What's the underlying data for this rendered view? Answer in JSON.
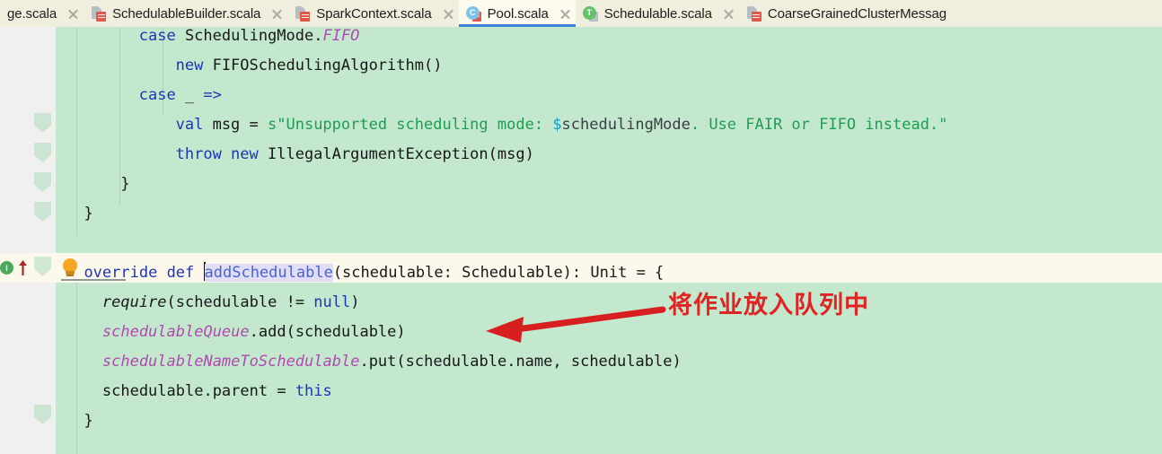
{
  "tabs": [
    {
      "label": "ge.scala",
      "icon": "scala-file-icon",
      "active": false,
      "truncated_left": true
    },
    {
      "label": "SchedulableBuilder.scala",
      "icon": "scala-file-icon",
      "active": false
    },
    {
      "label": "SparkContext.scala",
      "icon": "scala-file-icon",
      "active": false
    },
    {
      "label": "Pool.scala",
      "icon": "scala-class-icon",
      "active": true,
      "icon_letter": "C"
    },
    {
      "label": "Schedulable.scala",
      "icon": "scala-trait-icon",
      "active": false,
      "icon_letter": "T"
    },
    {
      "label": "CoarseGrainedClusterMessag",
      "icon": "scala-file-icon",
      "active": false,
      "truncated_right": true
    }
  ],
  "gutter": {
    "implementation_marker_letter": "I",
    "implementing_method_arrow": "override-arrow-up"
  },
  "editor": {
    "language": "scala",
    "lines": [
      {
        "indent": 4,
        "clipped_top": true,
        "tokens": [
          {
            "t": "case ",
            "c": "kw"
          },
          {
            "t": "SchedulingMode.",
            "c": "ident"
          },
          {
            "t": "FIFO",
            "c": "fld"
          }
        ]
      },
      {
        "indent": 6,
        "tokens": [
          {
            "t": "new ",
            "c": "kw"
          },
          {
            "t": "FIFOSchedulingAlgorithm()",
            "c": "ident"
          }
        ]
      },
      {
        "indent": 4,
        "tokens": [
          {
            "t": "case ",
            "c": "kw"
          },
          {
            "t": "_ ",
            "c": "ident"
          },
          {
            "t": "=>",
            "c": "kw"
          }
        ]
      },
      {
        "indent": 6,
        "tokens": [
          {
            "t": "val ",
            "c": "kw"
          },
          {
            "t": "msg ",
            "c": "ident"
          },
          {
            "t": "= ",
            "c": "ident"
          },
          {
            "t": "s\"Unsupported scheduling mode: ",
            "c": "str"
          },
          {
            "t": "$",
            "c": "itp"
          },
          {
            "t": "schedulingMode",
            "c": "itpv"
          },
          {
            "t": ". Use FAIR or FIFO instead.\"",
            "c": "str"
          }
        ]
      },
      {
        "indent": 6,
        "tokens": [
          {
            "t": "throw ",
            "c": "kw"
          },
          {
            "t": "new ",
            "c": "kw"
          },
          {
            "t": "IllegalArgumentException(msg)",
            "c": "ident"
          }
        ]
      },
      {
        "indent": 3,
        "tokens": [
          {
            "t": "}",
            "c": "ident"
          }
        ]
      },
      {
        "indent": 1,
        "tokens": [
          {
            "t": "}",
            "c": "ident"
          }
        ]
      },
      {
        "blank": true
      },
      {
        "indent": 1,
        "current": true,
        "tokens": [
          {
            "t": "override ",
            "c": "kw"
          },
          {
            "t": "def ",
            "c": "kw"
          },
          {
            "t": "|CARET|",
            "c": "caret"
          },
          {
            "t": "addSchedulable",
            "c": "sel-ident"
          },
          {
            "t": "(schedulable: Schedulable): Unit = {",
            "c": "ident"
          }
        ]
      },
      {
        "indent": 2,
        "tokens": [
          {
            "t": "require",
            "c": "mth"
          },
          {
            "t": "(schedulable != ",
            "c": "ident"
          },
          {
            "t": "null",
            "c": "kw"
          },
          {
            "t": ")",
            "c": "ident"
          }
        ]
      },
      {
        "indent": 2,
        "tokens": [
          {
            "t": "schedulableQueue",
            "c": "fld"
          },
          {
            "t": ".add(schedulable)",
            "c": "ident"
          }
        ]
      },
      {
        "indent": 2,
        "tokens": [
          {
            "t": "schedulableNameToSchedulable",
            "c": "fld"
          },
          {
            "t": ".put(schedulable.name, schedulable)",
            "c": "ident"
          }
        ]
      },
      {
        "indent": 2,
        "tokens": [
          {
            "t": "schedulable.parent = ",
            "c": "ident"
          },
          {
            "t": "this",
            "c": "kw"
          }
        ]
      },
      {
        "indent": 1,
        "tokens": [
          {
            "t": "}",
            "c": "ident"
          }
        ]
      }
    ]
  },
  "annotation": {
    "text": "将作业放入队列中",
    "color": "#e02424",
    "arrow": "left-pointing-arrow"
  },
  "colors": {
    "editor_background": "#c3e8ce",
    "current_line": "#fdf8ec",
    "tabbar_background": "#f0eedd",
    "active_tab_underline": "#3a85d6",
    "gutter_background": "#f0f0f0",
    "keyword": "#1d36b8",
    "string": "#219c52",
    "field": "#b04ab0",
    "annotation_red": "#e02424"
  }
}
